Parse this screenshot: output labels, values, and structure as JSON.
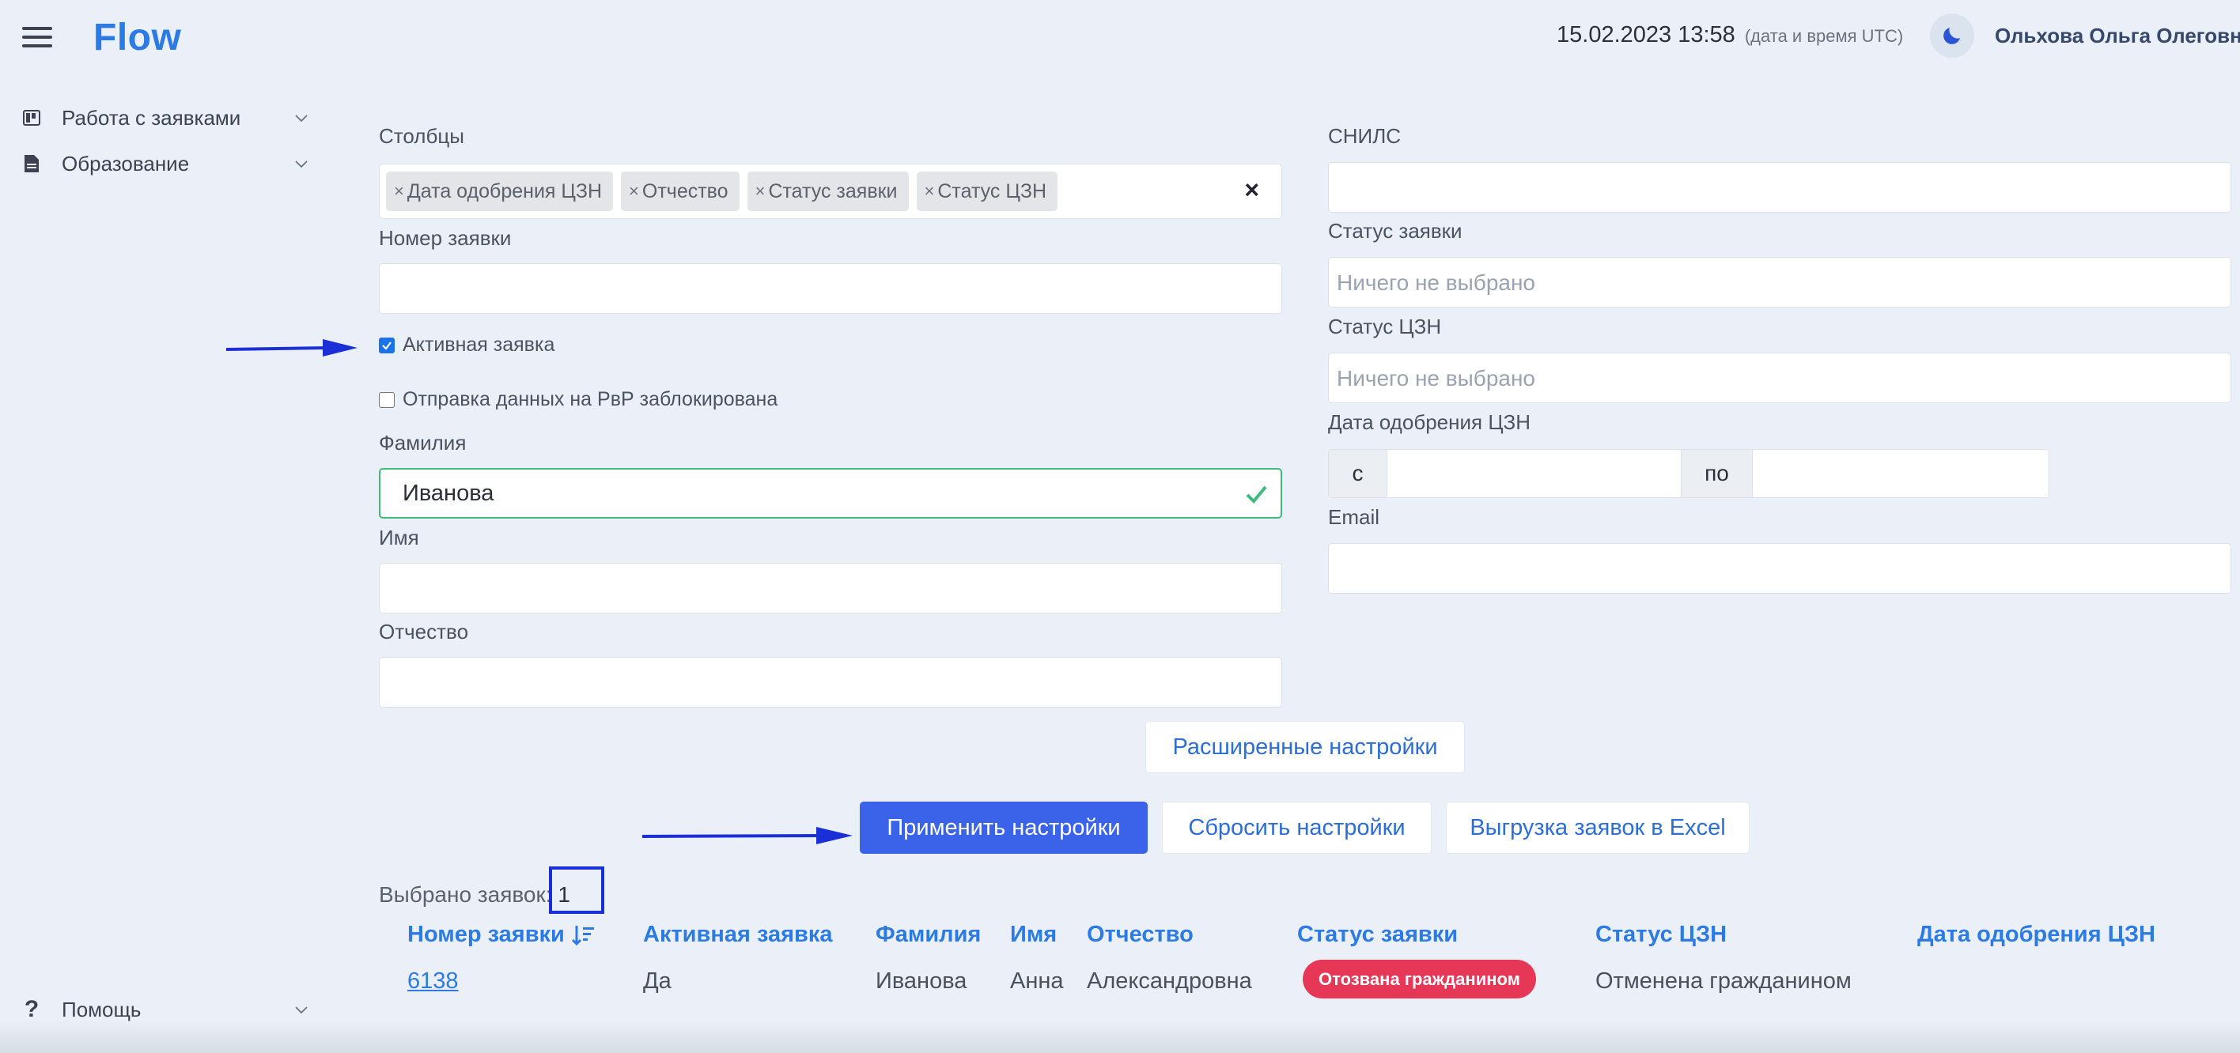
{
  "header": {
    "logo": "Flow",
    "datetime": "15.02.2023 13:58",
    "datetime_note": "(дата и время UTC)",
    "user_name": "Ольхова Ольга Олеговна"
  },
  "sidebar": {
    "items": [
      {
        "label": "Работа с заявками",
        "icon": "board-icon"
      },
      {
        "label": "Образование",
        "icon": "document-icon"
      }
    ],
    "help": {
      "label": "Помощь",
      "icon": "question-icon"
    }
  },
  "filters": {
    "columns": {
      "label": "Столбцы",
      "tags": [
        "Дата одобрения ЦЗН",
        "Отчество",
        "Статус заявки",
        "Статус ЦЗН"
      ],
      "tag_remove": "×",
      "clear": "×"
    },
    "request_number": {
      "label": "Номер заявки",
      "value": ""
    },
    "active_request": {
      "label": "Активная заявка",
      "checked": true
    },
    "rvr_blocked": {
      "label": "Отправка данных на РвР заблокирована",
      "checked": false
    },
    "last_name": {
      "label": "Фамилия",
      "value": "Иванова"
    },
    "first_name": {
      "label": "Имя",
      "value": ""
    },
    "middle_name": {
      "label": "Отчество",
      "value": ""
    },
    "snils": {
      "label": "СНИЛС",
      "value": ""
    },
    "request_status": {
      "label": "Статус заявки",
      "placeholder": "Ничего не выбрано"
    },
    "czn_status": {
      "label": "Статус ЦЗН",
      "placeholder": "Ничего не выбрано"
    },
    "czn_approval_date": {
      "label": "Дата одобрения ЦЗН",
      "from_label": "с",
      "to_label": "по"
    },
    "email": {
      "label": "Email",
      "value": ""
    }
  },
  "buttons": {
    "advanced": "Расширенные настройки",
    "apply": "Применить настройки",
    "reset": "Сбросить настройки",
    "export": "Выгрузка заявок в Excel"
  },
  "results": {
    "selected_label": "Выбрано заявок:",
    "selected_count": "1",
    "columns": [
      "Номер заявки",
      "Активная заявка",
      "Фамилия",
      "Имя",
      "Отчество",
      "Статус заявки",
      "Статус ЦЗН",
      "Дата одобрения ЦЗН"
    ],
    "rows": [
      {
        "number": "6138",
        "active": "Да",
        "last_name": "Иванова",
        "first_name": "Анна",
        "middle_name": "Александровна",
        "status": "Отозвана гражданином",
        "czn_status": "Отменена гражданином",
        "czn_date": ""
      }
    ]
  },
  "colors": {
    "accent": "#2c7be5",
    "primary_button": "#3b63e9",
    "danger_badge": "#e63757",
    "valid_border": "#3dbb7b",
    "annotation": "#1a2fd6"
  }
}
